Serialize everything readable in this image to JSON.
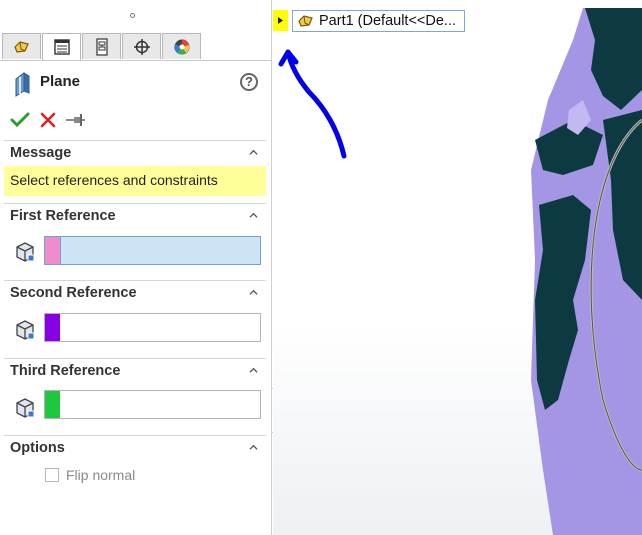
{
  "property_manager": {
    "title": "Plane",
    "tabs": [
      {
        "icon": "feature-manager-tree-icon"
      },
      {
        "icon": "property-manager-icon"
      },
      {
        "icon": "configuration-manager-icon"
      },
      {
        "icon": "dimxpert-manager-icon"
      },
      {
        "icon": "display-manager-icon"
      }
    ],
    "actions": {
      "ok": "checkmark-icon",
      "cancel": "close-icon",
      "pin": "pushpin-icon"
    },
    "message": {
      "header": "Message",
      "text": "Select references and constraints"
    },
    "first_reference": {
      "header": "First Reference",
      "color": "#f08ccc"
    },
    "second_reference": {
      "header": "Second Reference",
      "color": "#8a00e6"
    },
    "third_reference": {
      "header": "Third Reference",
      "color": "#1ec83c"
    },
    "options": {
      "header": "Options",
      "flip_normal_label": "Flip normal",
      "flip_normal_checked": false
    }
  },
  "graphics_area": {
    "feature_tree_node": "Part1  (Default<<De...",
    "model_color": "#a08ce0",
    "annotation_color": "#0000ee"
  }
}
